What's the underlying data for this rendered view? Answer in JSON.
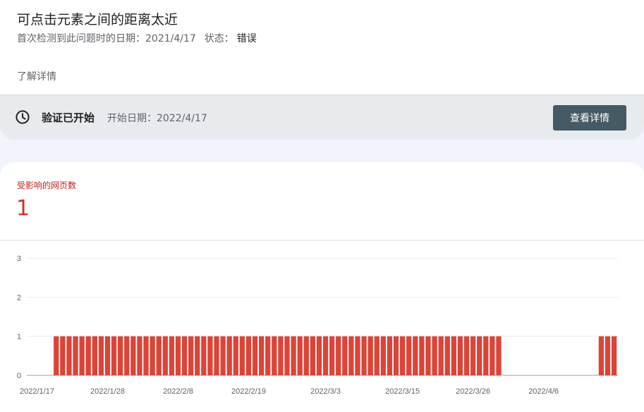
{
  "issue": {
    "title": "可点击元素之间的距离太近",
    "first_detected_label": "首次检测到此问题时的日期：",
    "first_detected_date": "2021/4/17",
    "status_label": "状态：",
    "status_value": "错误",
    "learn_more": "了解详情"
  },
  "validation": {
    "icon": "clock-icon",
    "title": "验证已开始",
    "start_label": "开始日期：",
    "start_date": "2022/4/17",
    "button_label": "查看详情"
  },
  "metric": {
    "label": "受影响的网页数",
    "value": "1"
  },
  "colors": {
    "bar": "#db4437",
    "metric": "#d93025",
    "button": "#455a64",
    "page_background": "#f1f4fb"
  },
  "chart_data": {
    "type": "bar",
    "ylim": [
      0,
      3
    ],
    "yticks": [
      0,
      1,
      2,
      3
    ],
    "x_tick_labels": [
      "2022/1/17",
      "2022/1/28",
      "2022/2/8",
      "2022/2/19",
      "2022/3/3",
      "2022/3/15",
      "2022/3/26",
      "2022/4/6"
    ],
    "grid": true,
    "legend": "none",
    "bar_spans": [
      {
        "from": "2022/1/20",
        "to": "2022/3/30",
        "value": 1
      },
      {
        "from": "2022/4/15",
        "to": "2022/4/17",
        "value": 1
      }
    ]
  }
}
